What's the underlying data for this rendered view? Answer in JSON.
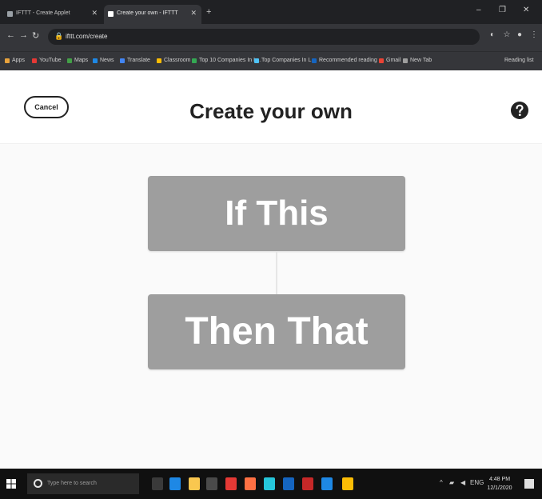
{
  "browser": {
    "tabs": [
      {
        "title": "IFTTT - Create Applet",
        "active": false
      },
      {
        "title": "Create your own - IFTTT",
        "active": true
      }
    ],
    "new_tab": "+",
    "window_controls": {
      "minimize": "–",
      "maximize": "❐",
      "close": "✕"
    },
    "nav": {
      "back": "←",
      "forward": "→",
      "reload": "↻"
    },
    "url": "ifttt.com/create",
    "bookmarks": [
      {
        "label": "Apps",
        "color": "#e8a33d"
      },
      {
        "label": "YouTube",
        "color": "#e53935"
      },
      {
        "label": "Maps",
        "color": "#43a047"
      },
      {
        "label": "News",
        "color": "#1e88e5"
      },
      {
        "label": "Translate",
        "color": "#4285f4"
      },
      {
        "label": "Classroom",
        "color": "#fbbc05"
      },
      {
        "label": "Top 10 Companies In L...",
        "color": "#34a853"
      },
      {
        "label": "Top Companies In L...",
        "color": "#4fc3f7"
      },
      {
        "label": "Recommended reading",
        "color": "#1565c0"
      },
      {
        "label": "Gmail",
        "color": "#ea4335"
      },
      {
        "label": "New Tab",
        "color": "#9e9e9e"
      }
    ],
    "reading_list": "Reading list"
  },
  "page": {
    "cancel_label": "Cancel",
    "title": "Create your own",
    "help_icon": "question-mark-icon",
    "if_label": "If This",
    "then_label": "Then That",
    "block_color": "#9e9e9e"
  },
  "taskbar": {
    "search_placeholder": "Type here to search",
    "apps": [
      {
        "name": "task-view",
        "color": "#3a3a3a"
      },
      {
        "name": "edge",
        "color": "#1e88e5"
      },
      {
        "name": "file-explorer",
        "color": "#f9c74f"
      },
      {
        "name": "store",
        "color": "#4a4a4a"
      },
      {
        "name": "opera",
        "color": "#e53935"
      },
      {
        "name": "firefox",
        "color": "#ff7043"
      },
      {
        "name": "chrome-alt",
        "color": "#26c6da"
      },
      {
        "name": "app-blue",
        "color": "#1565c0"
      },
      {
        "name": "app-red",
        "color": "#c62828"
      },
      {
        "name": "app-word",
        "color": "#1e88e5"
      },
      {
        "name": "chrome",
        "color": "#fbbc05"
      }
    ],
    "time": "4:48 PM",
    "date": "12/1/2020"
  }
}
